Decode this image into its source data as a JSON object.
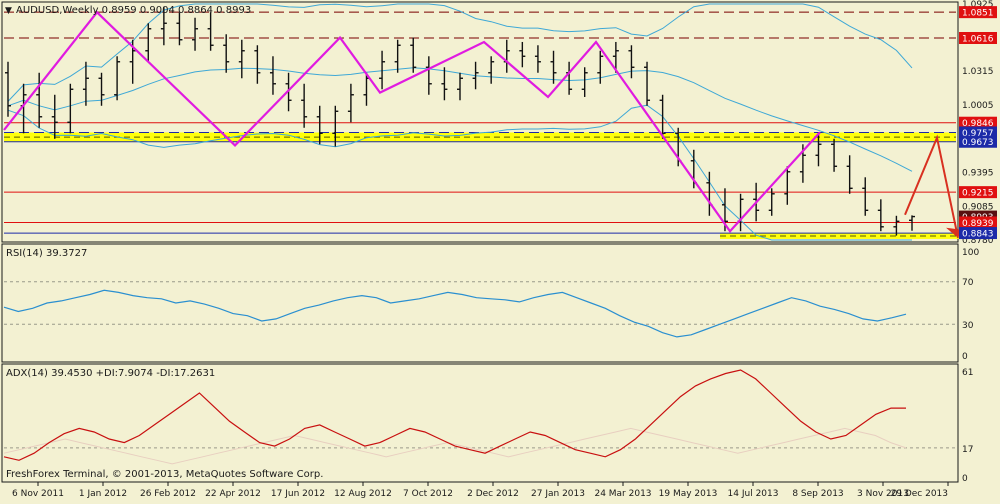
{
  "colors": {
    "background": "#f3f1d2",
    "frame": "#1a1a1a",
    "zigzag": "#e01be0",
    "bollinger": "#3ea8d6",
    "sma": "#2ea82e",
    "level_red": "#e01010",
    "level_blue": "#1c2aa8",
    "level_dark_red_dashed": "#7a0000",
    "yellow_zone": "#ffff00",
    "yellow_dash": "#5a5a00",
    "rsi_line": "#2a8fd0",
    "adx_line": "#c81010",
    "di_line": "#e8cfc0",
    "arrow": "#d83020",
    "price_tag_red": "#e01010",
    "price_tag_blue": "#1c2aa8",
    "price_tag_dark": "#5a1010"
  },
  "header": {
    "title": "AUDUSD,Weekly  0.8959 0.9004 0.8864 0.8993"
  },
  "rsi_panel": {
    "label": "RSI(14) 39.3727",
    "levels": [
      "100",
      "70",
      "30",
      "0"
    ]
  },
  "adx_panel": {
    "label": "ADX(14) 39.4530 +DI:7.9074 -DI:17.2631",
    "levels": [
      "61",
      "17",
      "0"
    ]
  },
  "footer": {
    "copyright": "FreshForex Terminal, © 2001-2013, MetaQuotes Software Corp."
  },
  "chart_data": {
    "type": "candlestick",
    "symbol": "AUDUSD",
    "timeframe": "Weekly",
    "ohlc_header": {
      "open": 0.8959,
      "high": 0.9004,
      "low": 0.8864,
      "close": 0.8993
    },
    "ylim": [
      0.878,
      1.0925
    ],
    "y_tick_labels": [
      "1.0925",
      "1.0851",
      "1.0616",
      "1.0315",
      "1.0005",
      "0.9846",
      "0.9757",
      "0.9673",
      "0.9395",
      "0.9215",
      "0.9085",
      "0.8993",
      "0.8939",
      "0.8843",
      "0.8780"
    ],
    "x_tick_labels": [
      "6 Nov 2011",
      "1 Jan 2012",
      "26 Feb 2012",
      "22 Apr 2012",
      "17 Jun 2012",
      "12 Aug 2012",
      "7 Oct 2012",
      "2 Dec 2012",
      "27 Jan 2013",
      "24 Mar 2013",
      "19 May 2013",
      "14 Jul 2013",
      "8 Sep 2013",
      "3 Nov 2013",
      "29 Dec 2013"
    ],
    "horizontal_levels": [
      {
        "price": 1.0851,
        "style": "dashed",
        "color": "#7a0000",
        "tag_color": "#e01010"
      },
      {
        "price": 1.0616,
        "style": "dashed",
        "color": "#7a0000",
        "tag_color": "#e01010"
      },
      {
        "price": 0.9846,
        "style": "solid",
        "color": "#e01010",
        "tag_color": "#e01010"
      },
      {
        "price": 0.9757,
        "style": "dashed",
        "color": "#1c2aa8",
        "tag_color": "#1c2aa8"
      },
      {
        "price": 0.9673,
        "style": "solid",
        "color": "#1c2aa8",
        "tag_color": "#1c2aa8"
      },
      {
        "price": 0.9215,
        "style": "solid",
        "color": "#e01010",
        "tag_color": "#e01010"
      },
      {
        "price": 0.8993,
        "style": "none",
        "color": "#5a1010",
        "tag_color": "#5a1010"
      },
      {
        "price": 0.8939,
        "style": "solid",
        "color": "#e01010",
        "tag_color": "#e01010"
      },
      {
        "price": 0.8843,
        "style": "solid",
        "color": "#1c2aa8",
        "tag_color": "#1c2aa8"
      }
    ],
    "zones": [
      {
        "from": 0.9673,
        "to": 0.9757
      },
      {
        "from": 0.879,
        "to": 0.8843
      }
    ],
    "zigzag": [
      {
        "x": "6 Nov 2011",
        "y": 0.978
      },
      {
        "x": "1 Jan 2012",
        "y": 1.085
      },
      {
        "x": "22 Apr 2012",
        "y": 0.964
      },
      {
        "x": "12 Aug 2012",
        "y": 1.062
      },
      {
        "x": "7 Oct 2012",
        "y": 1.012
      },
      {
        "x": "2 Dec 2012",
        "y": 1.058
      },
      {
        "x": "27 Jan 2013",
        "y": 1.008
      },
      {
        "x": "24 Mar 2013",
        "y": 1.058
      },
      {
        "x": "14 Jul 2013",
        "y": 0.886
      },
      {
        "x": "8 Sep 2013",
        "y": 0.976
      }
    ],
    "forecast_arrow": [
      {
        "x": "29 Dec 2013",
        "y": 0.901
      },
      {
        "x": "29 Dec 2013",
        "y": 0.971
      },
      {
        "x": "29 Dec 2013",
        "y": 0.88
      }
    ],
    "candles": [
      {
        "o": 1.03,
        "h": 1.04,
        "l": 0.99,
        "c": 1.0
      },
      {
        "o": 1.0,
        "h": 1.02,
        "l": 0.975,
        "c": 1.01
      },
      {
        "o": 1.01,
        "h": 1.03,
        "l": 0.98,
        "c": 0.99
      },
      {
        "o": 0.99,
        "h": 1.01,
        "l": 0.97,
        "c": 0.985
      },
      {
        "o": 0.985,
        "h": 1.02,
        "l": 0.975,
        "c": 1.015
      },
      {
        "o": 1.015,
        "h": 1.04,
        "l": 1.0,
        "c": 1.025
      },
      {
        "o": 1.025,
        "h": 1.03,
        "l": 1.0,
        "c": 1.01
      },
      {
        "o": 1.01,
        "h": 1.045,
        "l": 1.005,
        "c": 1.04
      },
      {
        "o": 1.04,
        "h": 1.06,
        "l": 1.02,
        "c": 1.05
      },
      {
        "o": 1.05,
        "h": 1.075,
        "l": 1.04,
        "c": 1.07
      },
      {
        "o": 1.07,
        "h": 1.09,
        "l": 1.055,
        "c": 1.075
      },
      {
        "o": 1.075,
        "h": 1.085,
        "l": 1.055,
        "c": 1.06
      },
      {
        "o": 1.06,
        "h": 1.08,
        "l": 1.05,
        "c": 1.07
      },
      {
        "o": 1.07,
        "h": 1.085,
        "l": 1.05,
        "c": 1.055
      },
      {
        "o": 1.055,
        "h": 1.065,
        "l": 1.03,
        "c": 1.04
      },
      {
        "o": 1.04,
        "h": 1.06,
        "l": 1.025,
        "c": 1.05
      },
      {
        "o": 1.05,
        "h": 1.055,
        "l": 1.02,
        "c": 1.03
      },
      {
        "o": 1.03,
        "h": 1.045,
        "l": 1.01,
        "c": 1.02
      },
      {
        "o": 1.02,
        "h": 1.03,
        "l": 0.995,
        "c": 1.005
      },
      {
        "o": 1.005,
        "h": 1.02,
        "l": 0.98,
        "c": 0.99
      },
      {
        "o": 0.99,
        "h": 1.0,
        "l": 0.965,
        "c": 0.975
      },
      {
        "o": 0.975,
        "h": 1.0,
        "l": 0.963,
        "c": 0.995
      },
      {
        "o": 0.995,
        "h": 1.02,
        "l": 0.985,
        "c": 1.01
      },
      {
        "o": 1.01,
        "h": 1.03,
        "l": 1.0,
        "c": 1.025
      },
      {
        "o": 1.025,
        "h": 1.05,
        "l": 1.015,
        "c": 1.04
      },
      {
        "o": 1.04,
        "h": 1.06,
        "l": 1.03,
        "c": 1.055
      },
      {
        "o": 1.055,
        "h": 1.062,
        "l": 1.03,
        "c": 1.035
      },
      {
        "o": 1.035,
        "h": 1.045,
        "l": 1.01,
        "c": 1.02
      },
      {
        "o": 1.02,
        "h": 1.035,
        "l": 1.005,
        "c": 1.015
      },
      {
        "o": 1.015,
        "h": 1.03,
        "l": 1.005,
        "c": 1.025
      },
      {
        "o": 1.025,
        "h": 1.04,
        "l": 1.015,
        "c": 1.03
      },
      {
        "o": 1.03,
        "h": 1.045,
        "l": 1.02,
        "c": 1.04
      },
      {
        "o": 1.04,
        "h": 1.06,
        "l": 1.03,
        "c": 1.05
      },
      {
        "o": 1.05,
        "h": 1.058,
        "l": 1.035,
        "c": 1.045
      },
      {
        "o": 1.045,
        "h": 1.055,
        "l": 1.03,
        "c": 1.04
      },
      {
        "o": 1.04,
        "h": 1.05,
        "l": 1.02,
        "c": 1.03
      },
      {
        "o": 1.03,
        "h": 1.04,
        "l": 1.01,
        "c": 1.015
      },
      {
        "o": 1.015,
        "h": 1.035,
        "l": 1.008,
        "c": 1.03
      },
      {
        "o": 1.03,
        "h": 1.05,
        "l": 1.02,
        "c": 1.045
      },
      {
        "o": 1.045,
        "h": 1.058,
        "l": 1.03,
        "c": 1.05
      },
      {
        "o": 1.05,
        "h": 1.055,
        "l": 1.025,
        "c": 1.035
      },
      {
        "o": 1.035,
        "h": 1.04,
        "l": 1.0,
        "c": 1.005
      },
      {
        "o": 1.005,
        "h": 1.01,
        "l": 0.97,
        "c": 0.975
      },
      {
        "o": 0.975,
        "h": 0.98,
        "l": 0.945,
        "c": 0.95
      },
      {
        "o": 0.95,
        "h": 0.96,
        "l": 0.925,
        "c": 0.93
      },
      {
        "o": 0.93,
        "h": 0.94,
        "l": 0.9,
        "c": 0.91
      },
      {
        "o": 0.91,
        "h": 0.925,
        "l": 0.886,
        "c": 0.895
      },
      {
        "o": 0.895,
        "h": 0.92,
        "l": 0.886,
        "c": 0.915
      },
      {
        "o": 0.915,
        "h": 0.93,
        "l": 0.895,
        "c": 0.905
      },
      {
        "o": 0.905,
        "h": 0.925,
        "l": 0.9,
        "c": 0.92
      },
      {
        "o": 0.92,
        "h": 0.945,
        "l": 0.91,
        "c": 0.94
      },
      {
        "o": 0.94,
        "h": 0.965,
        "l": 0.93,
        "c": 0.955
      },
      {
        "o": 0.955,
        "h": 0.976,
        "l": 0.945,
        "c": 0.965
      },
      {
        "o": 0.965,
        "h": 0.97,
        "l": 0.94,
        "c": 0.945
      },
      {
        "o": 0.945,
        "h": 0.955,
        "l": 0.92,
        "c": 0.925
      },
      {
        "o": 0.925,
        "h": 0.935,
        "l": 0.9,
        "c": 0.905
      },
      {
        "o": 0.905,
        "h": 0.915,
        "l": 0.886,
        "c": 0.89
      },
      {
        "o": 0.89,
        "h": 0.9,
        "l": 0.882,
        "c": 0.895
      },
      {
        "o": 0.8959,
        "h": 0.9004,
        "l": 0.8864,
        "c": 0.8993
      }
    ],
    "rsi": {
      "name": "RSI(14)",
      "last": 39.3727,
      "ylim": [
        0,
        100
      ],
      "levels": [
        30,
        70
      ],
      "values": [
        46,
        42,
        45,
        50,
        52,
        55,
        58,
        62,
        60,
        57,
        55,
        54,
        50,
        52,
        49,
        45,
        40,
        38,
        33,
        35,
        40,
        45,
        48,
        52,
        55,
        57,
        55,
        50,
        52,
        54,
        57,
        60,
        58,
        55,
        54,
        53,
        51,
        55,
        58,
        60,
        55,
        50,
        45,
        38,
        32,
        28,
        22,
        18,
        20,
        25,
        30,
        35,
        40,
        45,
        50,
        55,
        52,
        47,
        44,
        40,
        35,
        33,
        36,
        39.4
      ]
    },
    "adx": {
      "name": "ADX(14)",
      "last": 39.453,
      "plus_di": 7.9074,
      "minus_di": 17.2631,
      "ylim": [
        0,
        61
      ],
      "levels": [
        17
      ],
      "values": [
        12,
        10,
        14,
        20,
        25,
        28,
        26,
        22,
        20,
        24,
        30,
        36,
        42,
        48,
        40,
        32,
        26,
        20,
        18,
        22,
        28,
        30,
        26,
        22,
        18,
        20,
        24,
        28,
        26,
        22,
        18,
        16,
        14,
        18,
        22,
        26,
        24,
        20,
        16,
        14,
        12,
        16,
        22,
        30,
        38,
        46,
        52,
        56,
        59,
        61,
        56,
        48,
        40,
        32,
        26,
        22,
        24,
        30,
        36,
        39.5,
        39.5
      ],
      "di_values": [
        14,
        16,
        18,
        20,
        22,
        20,
        18,
        16,
        14,
        12,
        10,
        8,
        10,
        12,
        14,
        16,
        18,
        20,
        22,
        24,
        22,
        20,
        18,
        16,
        14,
        12,
        14,
        16,
        18,
        20,
        18,
        16,
        14,
        12,
        14,
        16,
        18,
        20,
        22,
        24,
        26,
        28,
        26,
        24,
        22,
        20,
        18,
        16,
        14,
        16,
        18,
        20,
        22,
        24,
        26,
        28,
        26,
        24,
        20,
        17
      ]
    }
  }
}
